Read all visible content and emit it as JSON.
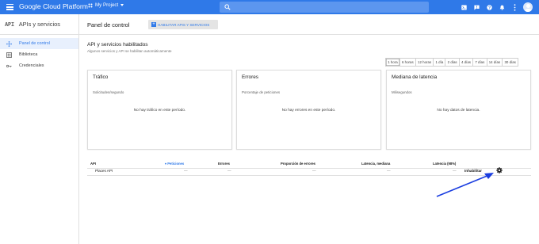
{
  "topbar": {
    "brand": "Google Cloud Platform",
    "project_name": "My Project",
    "accent_color": "#2f79e8",
    "icons": [
      "menu-icon",
      "project-dots-icon",
      "search-icon",
      "cloud-shell-icon",
      "notifications-icon",
      "help-icon",
      "bell-icon",
      "more-vert-icon",
      "account-avatar"
    ]
  },
  "sidebar": {
    "logo": "API",
    "title": "APIs y servicios",
    "items": [
      {
        "label": "Panel de control",
        "icon": "dashboard-icon",
        "active": true
      },
      {
        "label": "Biblioteca",
        "icon": "library-icon",
        "active": false
      },
      {
        "label": "Credenciales",
        "icon": "key-icon",
        "active": false
      }
    ]
  },
  "main": {
    "title": "Panel de control",
    "enable_button": "HABILITAR APIS Y SERVICIOS",
    "section_title": "API y servicios habilitados",
    "section_subtitle": "Algunos servicios y API se habilitan automáticamente",
    "time_tabs": [
      "1 hora",
      "6 horas",
      "12 horas",
      "1 día",
      "2 días",
      "4 días",
      "7 días",
      "14 días",
      "30 días"
    ],
    "selected_time_tab": "1 hora",
    "cards": [
      {
        "title": "Tráfico",
        "subtitle": "Solicitudes/segundo",
        "empty": "No hay tráfico en este período."
      },
      {
        "title": "Errores",
        "subtitle": "Porcentaje de peticiones",
        "empty": "No hay errores en este período."
      },
      {
        "title": "Mediana de latencia",
        "subtitle": "Milisegundos",
        "empty": "No hay datos de latencia."
      }
    ],
    "table": {
      "headers": {
        "api": "API",
        "requests": "Peticiones",
        "errors": "Errores",
        "error_ratio": "Proporción de errores",
        "latency_median": "Latencia, mediana",
        "latency_98": "Latencia (98%)"
      },
      "rows": [
        {
          "api": "Places API",
          "requests": "—",
          "errors": "—",
          "error_ratio": "—",
          "latency_median": "—",
          "latency_98": "—",
          "action": "Inhabilitar"
        }
      ]
    }
  }
}
